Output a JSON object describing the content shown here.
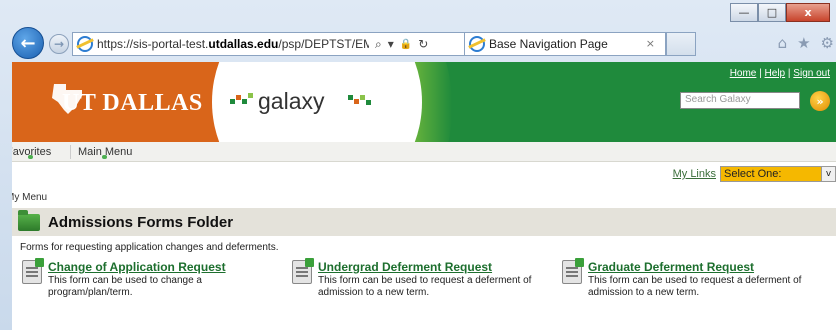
{
  "browser": {
    "url_prefix": "https://sis-portal-test.",
    "url_domain": "utdallas.edu",
    "url_suffix": "/psp/DEPTST/EMPLOYEI",
    "search_glyph": "⌕",
    "dropdown_glyph": "▾",
    "lock_glyph": "🔒",
    "refresh_glyph": "↻",
    "tab_title": "Base Navigation Page",
    "tab_close": "×",
    "back_glyph": "←",
    "fwd_glyph": "→",
    "home_glyph": "⌂",
    "fav_glyph": "★",
    "settings_glyph": "⚙",
    "min_glyph": "—",
    "max_glyph": "□",
    "close_glyph": "x"
  },
  "header": {
    "logo_text": "UT DALLAS",
    "app_name": "galaxy",
    "links": {
      "home": "Home",
      "help": "Help",
      "signout": "Sign out",
      "sep": "|"
    },
    "search_placeholder": "Search Galaxy",
    "search_go": "»"
  },
  "nav": {
    "favorites": "Favorites",
    "main_menu": "Main Menu"
  },
  "mylinks": {
    "label": "My Links",
    "select_value": "Select One:",
    "select_arrow": "v"
  },
  "breadcrumb": "My Menu",
  "folder": {
    "title": "Admissions Forms Folder",
    "description": "Forms for requesting application changes and deferments."
  },
  "items": [
    {
      "title": "Change of Application Request",
      "description": "This form can be used to change a program/plan/term."
    },
    {
      "title": "Undergrad Deferment Request",
      "description": "This form can be used to request a deferment of admission to a new term."
    },
    {
      "title": "Graduate Deferment Request",
      "description": "This form can be used to request a deferment of admission to a new term."
    }
  ],
  "colors": {
    "brand_green": "#1f8a3c",
    "brand_orange": "#d9651a",
    "link_green": "#1d6f2e",
    "select_bg": "#f5b800"
  }
}
